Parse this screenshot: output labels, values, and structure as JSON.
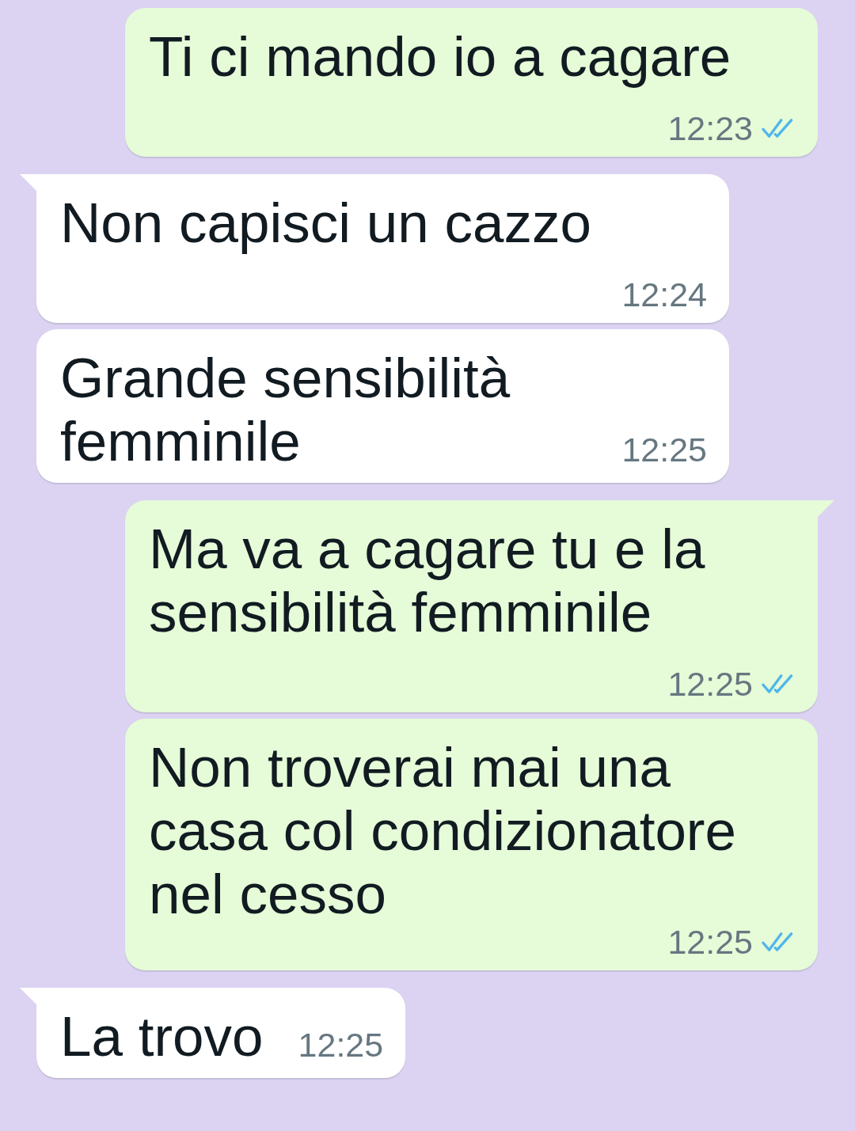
{
  "messages": [
    {
      "kind": "outgoing",
      "tail": false,
      "text": "Ti ci mando io a cagare",
      "time": "12:23",
      "read": true
    },
    {
      "kind": "incoming",
      "tail": true,
      "text": "Non capisci un cazzo",
      "time": "12:24"
    },
    {
      "kind": "incoming",
      "tail": false,
      "text": "Grande sensibilità femminile",
      "time": "12:25"
    },
    {
      "kind": "outgoing",
      "tail": true,
      "text": "Ma va a cagare tu e la sensibilità femminile",
      "time": "12:25",
      "read": true
    },
    {
      "kind": "outgoing",
      "tail": false,
      "text": "Non troverai mai una casa col condizionatore nel cesso",
      "time": "12:25",
      "read": true
    },
    {
      "kind": "incoming",
      "tail": true,
      "text": "La trovo",
      "time": "12:25"
    }
  ]
}
